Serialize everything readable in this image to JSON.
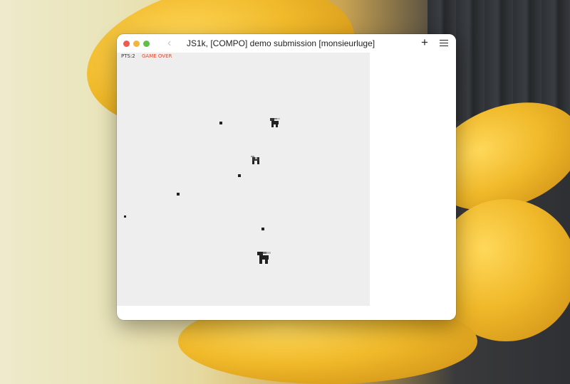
{
  "window": {
    "title": "JS1k, [COMPO] demo submission [monsieurluge]",
    "back_icon": "chevron-left-icon",
    "new_tab_icon": "plus-icon",
    "menu_icon": "hamburger-menu-icon"
  },
  "game": {
    "points_label": "PTS:2",
    "status_label": "GAME OVER",
    "status_color": "#e04a2c",
    "background_color": "#eeeeee",
    "dots": 6,
    "creatures": 3
  }
}
